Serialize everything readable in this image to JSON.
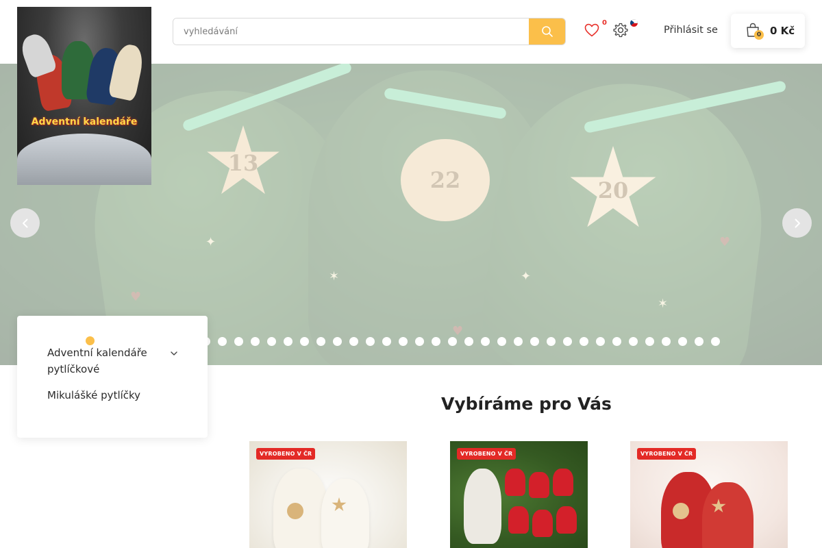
{
  "header": {
    "search": {
      "placeholder": "vyhledávání"
    },
    "favorites": {
      "count": "0"
    },
    "login_label": "Přihlásit se",
    "cart": {
      "count": "0",
      "price": "0 Kč"
    },
    "language": "cs"
  },
  "logo": {
    "text": "Adventní kalendáře"
  },
  "hero": {
    "tags": [
      "13",
      "22",
      "20"
    ],
    "slide_count": 32
  },
  "categories": [
    {
      "label": "Adventní kalendáře pytlíčkové",
      "expandable": true
    },
    {
      "label": "Mikulášké pytlíčky",
      "expandable": false
    }
  ],
  "section": {
    "title": "Vybíráme pro Vás"
  },
  "products": [
    {
      "badge": "VYROBENO V ČR"
    },
    {
      "badge": "VYROBENO V ČR"
    },
    {
      "badge": "VYROBENO V ČR"
    }
  ],
  "colors": {
    "accent": "#fbbf4a",
    "badge_red": "#e32a26",
    "favorite_count": "#e8302a"
  },
  "icons": [
    "search-icon",
    "heart-icon",
    "gear-icon",
    "czech-flag-icon",
    "shopping-bag-icon",
    "chevron-left-icon",
    "chevron-right-icon",
    "chevron-down-icon"
  ]
}
